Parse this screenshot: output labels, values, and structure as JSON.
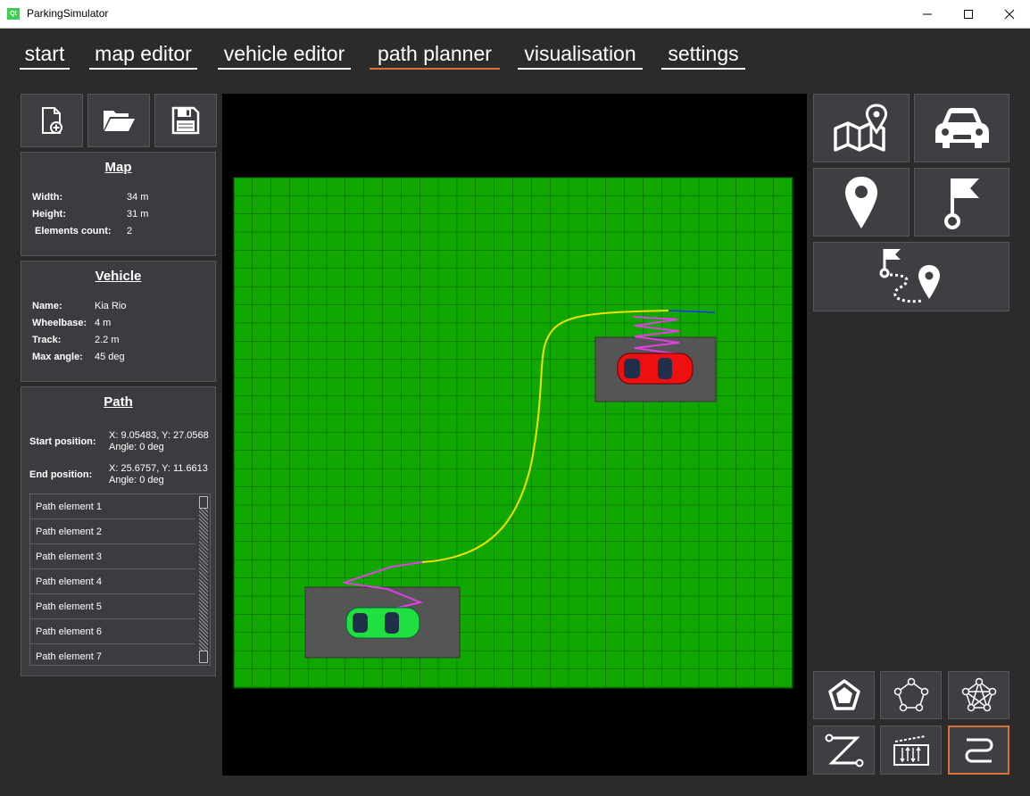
{
  "window": {
    "title": "ParkingSimulator",
    "icon_text": "Qt"
  },
  "tabs": [
    {
      "label": "start"
    },
    {
      "label": "map editor"
    },
    {
      "label": "vehicle editor"
    },
    {
      "label": "path planner"
    },
    {
      "label": "visualisation"
    },
    {
      "label": "settings"
    }
  ],
  "active_tab": "path planner",
  "map": {
    "title": "Map",
    "width_label": "Width:",
    "width_value": "34 m",
    "height_label": "Height:",
    "height_value": "31 m",
    "elements_label": "Elements count:",
    "elements_value": "2"
  },
  "vehicle": {
    "title": "Vehicle",
    "name_label": "Name:",
    "name_value": "Kia Rio",
    "wheelbase_label": "Wheelbase:",
    "wheelbase_value": "4 m",
    "track_label": "Track:",
    "track_value": "2.2 m",
    "max_angle_label": "Max angle:",
    "max_angle_value": "45 deg"
  },
  "path": {
    "title": "Path",
    "start_label": "Start position:",
    "start_value_1": "X: 9.05483, Y: 27.0568",
    "start_value_2": "Angle: 0 deg",
    "end_label": "End position:",
    "end_value_1": "X: 25.6757, Y: 11.6613",
    "end_value_2": "Angle: 0 deg",
    "elements": [
      "Path element 1",
      "Path element 2",
      "Path element 3",
      "Path element 4",
      "Path element 5",
      "Path element 6",
      "Path element 7"
    ]
  },
  "icons": {
    "new_file": "new-file-icon",
    "open_folder": "open-folder-icon",
    "save": "save-icon",
    "map": "map-icon",
    "car": "car-icon",
    "start_pin": "location-pin-icon",
    "end_flag": "flag-icon",
    "route": "route-icon",
    "alg1": "pentagon-icon",
    "alg2": "polygon-graph-icon",
    "alg3": "full-graph-icon",
    "alg4": "zigzag-path-icon",
    "alg5": "parking-arrows-icon",
    "alg6": "curve-path-icon"
  },
  "colors": {
    "background": "#2b2b2b",
    "panel": "#3a3c40",
    "accent": "#d7713a",
    "grass": "#10a800",
    "path_curve": "#f0e000",
    "path_maneuver": "#e040e0",
    "start_car": "#20e040",
    "end_car": "#ee1010"
  }
}
